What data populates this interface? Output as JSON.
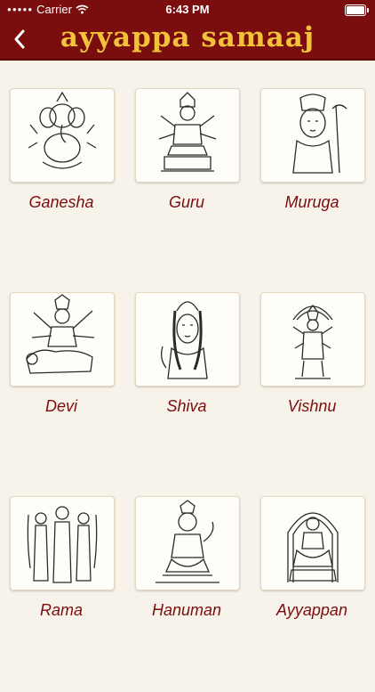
{
  "status": {
    "carrier": "Carrier",
    "time": "6:43 PM"
  },
  "nav": {
    "title": "ayyappa samaaj",
    "back_icon": "chevron-left-icon"
  },
  "colors": {
    "brand": "#7a0d0d",
    "title": "#f3c23b",
    "background": "#f8f3ea"
  },
  "deities": [
    {
      "name": "Ganesha",
      "icon": "ganesha-icon"
    },
    {
      "name": "Guru",
      "icon": "guru-icon"
    },
    {
      "name": "Muruga",
      "icon": "muruga-icon"
    },
    {
      "name": "Devi",
      "icon": "devi-icon"
    },
    {
      "name": "Shiva",
      "icon": "shiva-icon"
    },
    {
      "name": "Vishnu",
      "icon": "vishnu-icon"
    },
    {
      "name": "Rama",
      "icon": "rama-icon"
    },
    {
      "name": "Hanuman",
      "icon": "hanuman-icon"
    },
    {
      "name": "Ayyappan",
      "icon": "ayyappan-icon"
    }
  ]
}
